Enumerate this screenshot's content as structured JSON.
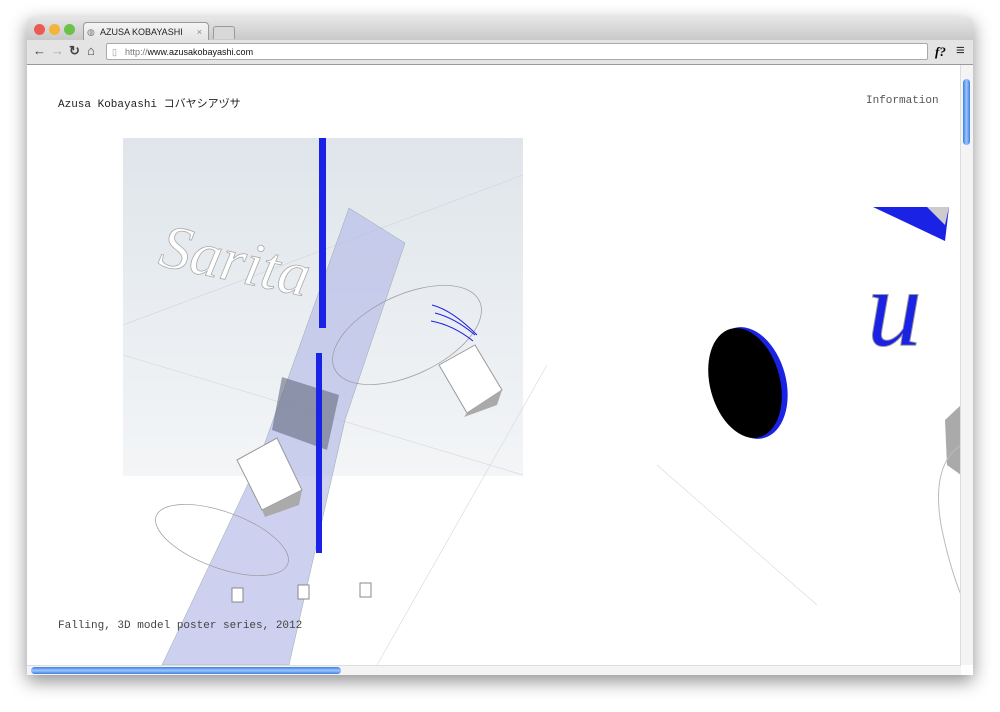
{
  "browser": {
    "tab_title": "AZUSA KOBAYASHI",
    "tab_close": "×",
    "url_prefix": "http://",
    "url_host": "www.azusakobayashi.com",
    "ext_label": "f?",
    "menu_label": "≡",
    "icons": [
      "back-icon",
      "forward-icon",
      "reload-icon",
      "home-icon",
      "page-icon",
      "menu-icon"
    ]
  },
  "page": {
    "site_title": "Azusa Kobayashi コバヤシアヅサ",
    "nav_information": "Information",
    "caption": "Falling, 3D model poster series, 2012",
    "artwork_text": "Sarita"
  },
  "colors": {
    "accent_blue": "#1a22e6",
    "scroll_blue": "#3d7fe0"
  }
}
